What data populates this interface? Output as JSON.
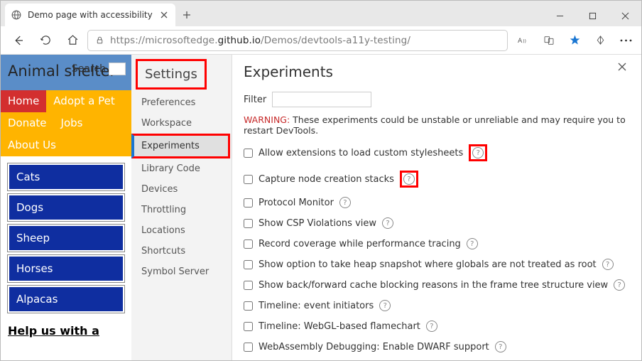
{
  "window": {
    "tab_title": "Demo page with accessibility iss",
    "url_proto": "https://",
    "url_sub": "microsoftedge.",
    "url_main": "github.io",
    "url_path": "/Demos/devtools-a11y-testing/"
  },
  "page": {
    "hero_title": "Animal shelter",
    "search_label": "Search",
    "nav": [
      "Home",
      "Adopt a Pet",
      "Donate",
      "Jobs",
      "About Us"
    ],
    "animals": [
      "Cats",
      "Dogs",
      "Sheep",
      "Horses",
      "Alpacas"
    ],
    "help_heading": "Help us with a"
  },
  "settings": {
    "title": "Settings",
    "sidebar": [
      "Preferences",
      "Workspace",
      "Experiments",
      "Library Code",
      "Devices",
      "Throttling",
      "Locations",
      "Shortcuts",
      "Symbol Server"
    ],
    "main_title": "Experiments",
    "filter_label": "Filter",
    "warning_prefix": "WARNING:",
    "warning_text": " These experiments could be unstable or unreliable and may require you to restart DevTools.",
    "experiments": [
      "Allow extensions to load custom stylesheets",
      "Capture node creation stacks",
      "Protocol Monitor",
      "Show CSP Violations view",
      "Record coverage while performance tracing",
      "Show option to take heap snapshot where globals are not treated as root",
      "Show back/forward cache blocking reasons in the frame tree structure view",
      "Timeline: event initiators",
      "Timeline: WebGL-based flamechart",
      "WebAssembly Debugging: Enable DWARF support"
    ]
  }
}
